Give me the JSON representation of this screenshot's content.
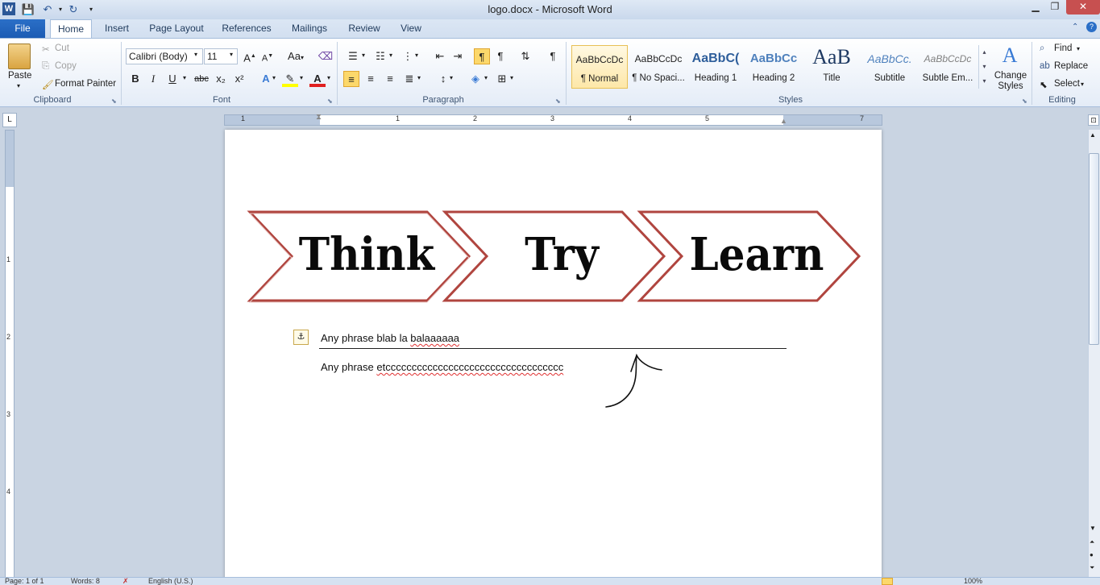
{
  "window": {
    "title": "logo.docx  -  Microsoft Word"
  },
  "tabs": [
    "File",
    "Home",
    "Insert",
    "Page Layout",
    "References",
    "Mailings",
    "Review",
    "View"
  ],
  "clipboard": {
    "paste": "Paste",
    "cut": "Cut",
    "copy": "Copy",
    "format_painter": "Format Painter",
    "label": "Clipboard"
  },
  "font": {
    "name": "Calibri (Body)",
    "size": "11",
    "case": "Aa",
    "label": "Font",
    "bold": "B",
    "italic": "I",
    "underline": "U",
    "strike": "abc",
    "sub": "x₂",
    "sup": "x²"
  },
  "paragraph": {
    "label": "Paragraph",
    "pilcrow": "¶"
  },
  "styles": {
    "label": "Styles",
    "items": [
      {
        "preview": "AaBbCcDc",
        "name": "¶ Normal"
      },
      {
        "preview": "AaBbCcDc",
        "name": "¶ No Spaci..."
      },
      {
        "preview": "AaBbC(",
        "name": "Heading 1"
      },
      {
        "preview": "AaBbCc",
        "name": "Heading 2"
      },
      {
        "preview": "AaB",
        "name": "Title"
      },
      {
        "preview": "AaBbCc.",
        "name": "Subtitle"
      },
      {
        "preview": "AaBbCcDc",
        "name": "Subtle Em..."
      }
    ],
    "change": "Change\nStyles"
  },
  "editing": {
    "label": "Editing",
    "find": "Find",
    "replace": "Replace",
    "select": "Select"
  },
  "ruler": {
    "h": [
      "1",
      "1",
      "2",
      "3",
      "4",
      "5",
      "7"
    ],
    "v": [
      "1",
      "2",
      "3",
      "4"
    ]
  },
  "document": {
    "arrows": [
      "Think",
      "Try",
      "Learn"
    ],
    "line1_plain": "Any phrase blab la ",
    "line1_err": "balaaaaaa",
    "line2_plain": "Any phrase ",
    "line2_err": "etcccccccccccccccccccccccccccccccccc"
  },
  "status": {
    "page": "Page: 1 of 1",
    "words": "Words: 8",
    "lang": "English (U.S.)",
    "zoom": "100%"
  },
  "colors": {
    "arrow_stroke": "#b0453f",
    "accent": "#2b6fc7"
  }
}
